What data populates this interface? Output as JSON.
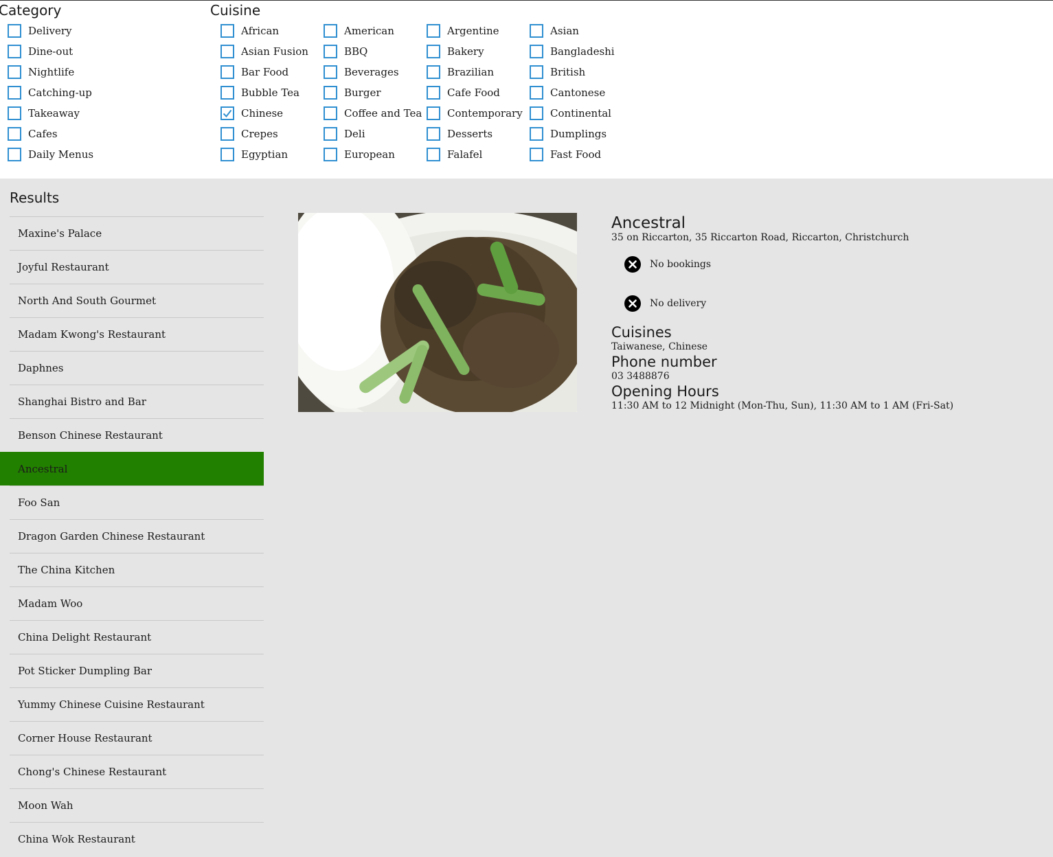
{
  "filters": {
    "category": {
      "title": "Category",
      "items": [
        {
          "label": "Delivery",
          "checked": false
        },
        {
          "label": "Dine-out",
          "checked": false
        },
        {
          "label": "Nightlife",
          "checked": false
        },
        {
          "label": "Catching-up",
          "checked": false
        },
        {
          "label": "Takeaway",
          "checked": false
        },
        {
          "label": "Cafes",
          "checked": false
        },
        {
          "label": "Daily Menus",
          "checked": false
        }
      ]
    },
    "cuisine": {
      "title": "Cuisine",
      "columns": [
        [
          {
            "label": "African",
            "checked": false
          },
          {
            "label": "Asian Fusion",
            "checked": false
          },
          {
            "label": "Bar Food",
            "checked": false
          },
          {
            "label": "Bubble Tea",
            "checked": false
          },
          {
            "label": "Chinese",
            "checked": true
          },
          {
            "label": "Crepes",
            "checked": false
          },
          {
            "label": "Egyptian",
            "checked": false
          }
        ],
        [
          {
            "label": "American",
            "checked": false
          },
          {
            "label": "BBQ",
            "checked": false
          },
          {
            "label": "Beverages",
            "checked": false
          },
          {
            "label": "Burger",
            "checked": false
          },
          {
            "label": "Coffee and Tea",
            "checked": false
          },
          {
            "label": "Deli",
            "checked": false
          },
          {
            "label": "European",
            "checked": false
          }
        ],
        [
          {
            "label": "Argentine",
            "checked": false
          },
          {
            "label": "Bakery",
            "checked": false
          },
          {
            "label": "Brazilian",
            "checked": false
          },
          {
            "label": "Cafe Food",
            "checked": false
          },
          {
            "label": "Contemporary",
            "checked": false
          },
          {
            "label": "Desserts",
            "checked": false
          },
          {
            "label": "Falafel",
            "checked": false
          }
        ],
        [
          {
            "label": "Asian",
            "checked": false
          },
          {
            "label": "Bangladeshi",
            "checked": false
          },
          {
            "label": "British",
            "checked": false
          },
          {
            "label": "Cantonese",
            "checked": false
          },
          {
            "label": "Continental",
            "checked": false
          },
          {
            "label": "Dumplings",
            "checked": false
          },
          {
            "label": "Fast Food",
            "checked": false
          }
        ]
      ]
    }
  },
  "results": {
    "title": "Results",
    "selected_index": 7,
    "items": [
      "Maxine's Palace",
      "Joyful Restaurant",
      "North And South Gourmet",
      "Madam Kwong's Restaurant",
      "Daphnes",
      "Shanghai Bistro and Bar",
      "Benson Chinese Restaurant",
      "Ancestral",
      "Foo San",
      "Dragon Garden Chinese Restaurant",
      "The China Kitchen",
      "Madam Woo",
      "China Delight Restaurant",
      "Pot Sticker Dumpling Bar",
      "Yummy Chinese Cuisine Restaurant",
      "Corner House Restaurant",
      "Chong's Chinese Restaurant",
      "Moon Wah",
      "China Wok Restaurant"
    ]
  },
  "detail": {
    "name": "Ancestral",
    "address": "35 on Riccarton, 35 Riccarton Road, Riccarton, Christchurch",
    "bookings": "No bookings",
    "delivery": "No delivery",
    "cuisines_heading": "Cuisines",
    "cuisines": "Taiwanese, Chinese",
    "phone_heading": "Phone number",
    "phone": "03 3488876",
    "hours_heading": "Opening Hours",
    "hours": "11:30 AM to 12 Midnight (Mon-Thu, Sun), 11:30 AM to 1 AM (Fri-Sat)"
  },
  "colors": {
    "checkbox_border": "#2f8fd1",
    "selected_row": "#228000",
    "panel_bg": "#e5e5e5"
  }
}
